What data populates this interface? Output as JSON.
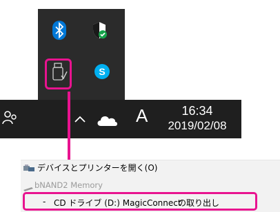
{
  "tray_popup": {
    "icons": [
      "bluetooth-icon",
      "windows-defender-icon",
      "usb-device-icon",
      "skype-icon"
    ]
  },
  "taskbar": {
    "ime_indicator": "A",
    "time": "16:34",
    "date": "2019/02/08",
    "icons": [
      "people-icon",
      "chevron-up-icon",
      "onedrive-cloud-icon"
    ]
  },
  "context_menu": {
    "open_devices_label": "デバイスとプリンターを開く(O)",
    "device_name": "bNAND2 Memory",
    "eject_item": {
      "dash": "-",
      "drive_label": "CD ドライブ (D:) MagicConnect",
      "action": "の取り出し"
    }
  },
  "colors": {
    "highlight": "#e8138f",
    "tray_bg": "#2b2b2b",
    "taskbar_bg": "#1f1f1f",
    "menu_bg": "#f2f2f2",
    "bluetooth_blue": "#0078d7",
    "skype_blue": "#00aff0"
  }
}
